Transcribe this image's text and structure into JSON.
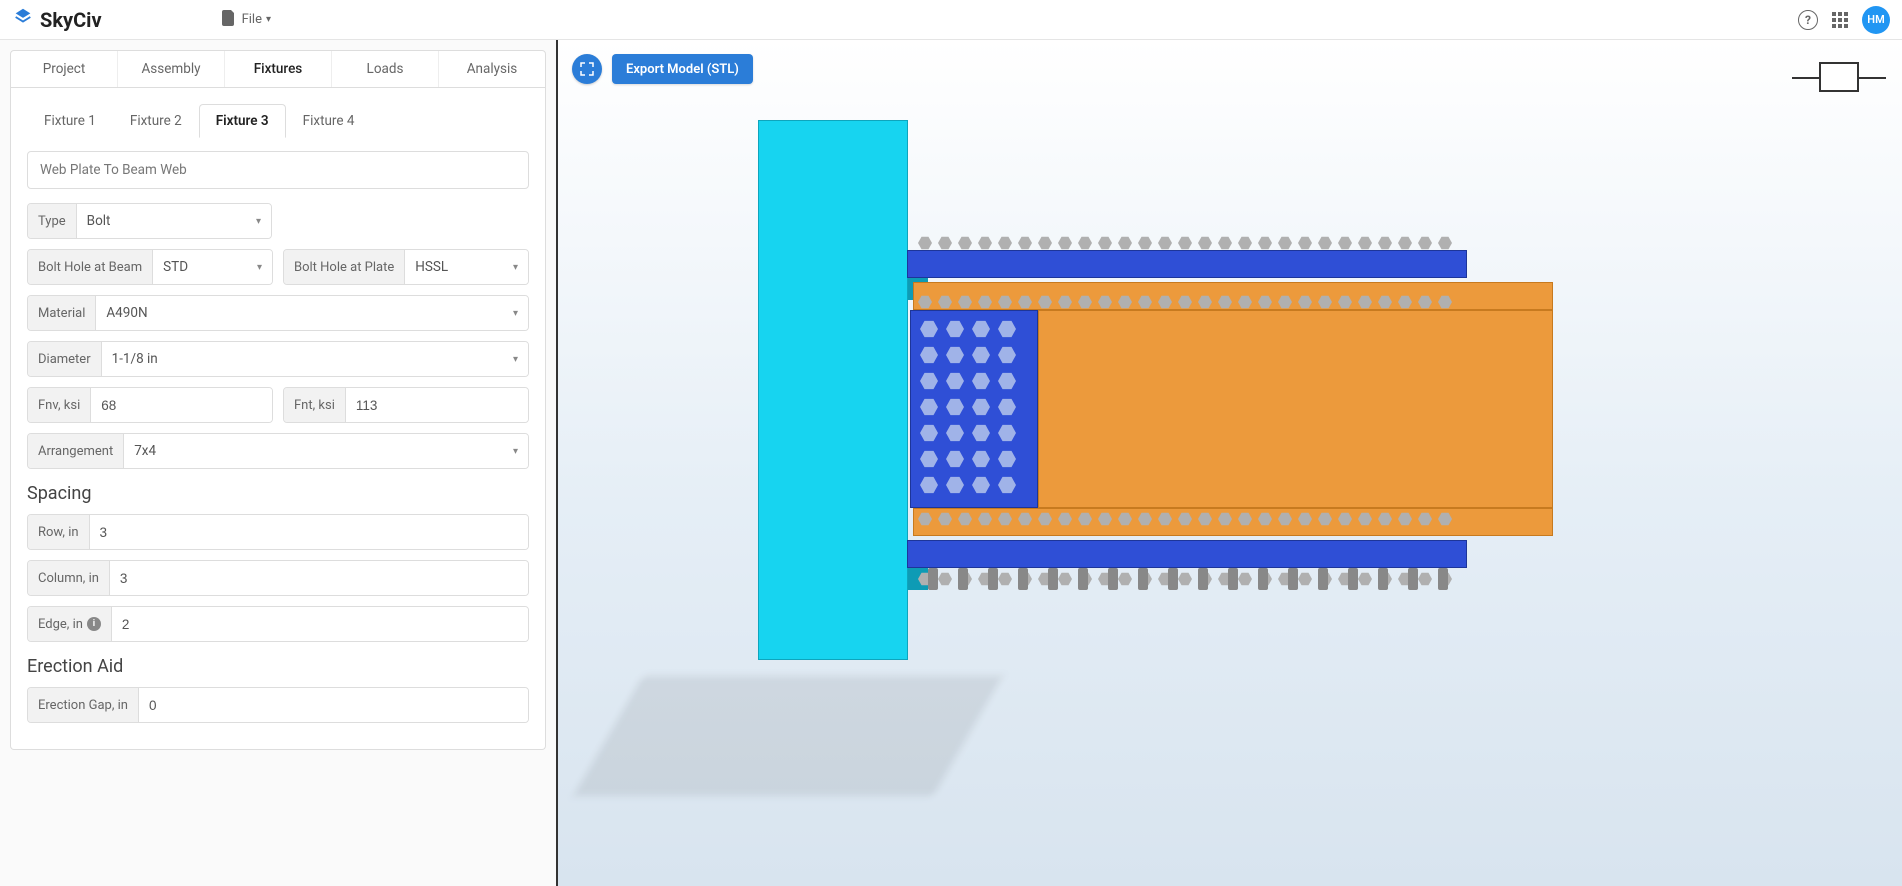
{
  "header": {
    "brand": "SkyCiv",
    "fileMenu": "File",
    "avatar": "HM"
  },
  "mainTabs": [
    {
      "label": "Project",
      "active": false
    },
    {
      "label": "Assembly",
      "active": false
    },
    {
      "label": "Fixtures",
      "active": true
    },
    {
      "label": "Loads",
      "active": false
    },
    {
      "label": "Analysis",
      "active": false
    }
  ],
  "subTabs": [
    {
      "label": "Fixture 1",
      "active": false
    },
    {
      "label": "Fixture 2",
      "active": false
    },
    {
      "label": "Fixture 3",
      "active": true
    },
    {
      "label": "Fixture 4",
      "active": false
    }
  ],
  "fixtureTitle": "Web Plate To Beam Web",
  "form": {
    "typeLabel": "Type",
    "typeValue": "Bolt",
    "boltHoleBeamLabel": "Bolt Hole at Beam",
    "boltHoleBeamValue": "STD",
    "boltHolePlateLabel": "Bolt Hole at Plate",
    "boltHolePlateValue": "HSSL",
    "materialLabel": "Material",
    "materialValue": "A490N",
    "diameterLabel": "Diameter",
    "diameterValue": "1-1/8 in",
    "fnvLabel": "Fnv, ksi",
    "fnvValue": "68",
    "fntLabel": "Fnt, ksi",
    "fntValue": "113",
    "arrangementLabel": "Arrangement",
    "arrangementValue": "7x4"
  },
  "spacing": {
    "heading": "Spacing",
    "rowLabel": "Row, in",
    "rowValue": "3",
    "columnLabel": "Column, in",
    "columnValue": "3",
    "edgeLabel": "Edge, in",
    "edgeValue": "2"
  },
  "erection": {
    "heading": "Erection Aid",
    "gapLabel": "Erection Gap, in",
    "gapValue": "0"
  },
  "viewport": {
    "exportLabel": "Export Model (STL)"
  }
}
